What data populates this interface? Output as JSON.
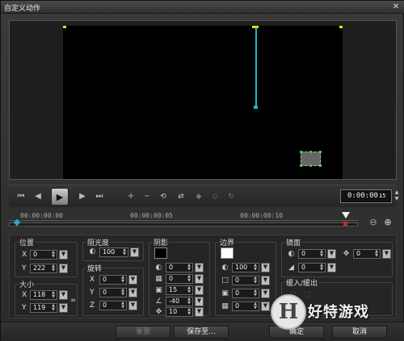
{
  "window": {
    "title": "自定义动作",
    "close_glyph": "✕"
  },
  "icons": {
    "go_start": "⏮",
    "prev_frame": "◀",
    "play": "▶",
    "next_frame": "▶",
    "go_end": "⏭",
    "zoom_out": "⊖",
    "zoom_in": "⊕"
  },
  "timecode": {
    "value": "0:00:00.",
    "frame": "15"
  },
  "ruler": {
    "ticks": [
      "00:00:00:00",
      "00:00:00:05",
      "00:00:00:10"
    ]
  },
  "groups": {
    "position": {
      "label": "位置",
      "x_label": "X",
      "x_value": "0",
      "y_label": "Y",
      "y_value": "222"
    },
    "size": {
      "label": "大小",
      "x_label": "X",
      "x_value": "118",
      "y_label": "Y",
      "y_value": "119"
    },
    "opacity": {
      "label": "阻光度",
      "value": "100"
    },
    "rotation": {
      "label": "旋转",
      "x_label": "X",
      "x_value": "0",
      "y_label": "Y",
      "y_value": "0",
      "z_label": "Z",
      "z_value": "0"
    },
    "shadow": {
      "label": "阴影",
      "values": [
        "0",
        "0",
        "15",
        "-40",
        "10"
      ]
    },
    "border": {
      "label": "边界",
      "values": [
        "100",
        "0",
        "0",
        "0"
      ]
    },
    "mirror": {
      "label": "镜面",
      "values": [
        "0",
        "0"
      ],
      "move_value": "0"
    },
    "fade": {
      "label": "缓入/缓出"
    }
  },
  "buttons": {
    "reset": "重置",
    "save_to": "保存至...",
    "ok": "确定",
    "cancel": "取消"
  },
  "watermark": {
    "logo_char": "H",
    "text": "好特游戏"
  },
  "colors": {
    "accent": "#1fb8c8",
    "marker": "#e8e000",
    "handle": "#3ec93e",
    "playhead": "#d22222"
  }
}
